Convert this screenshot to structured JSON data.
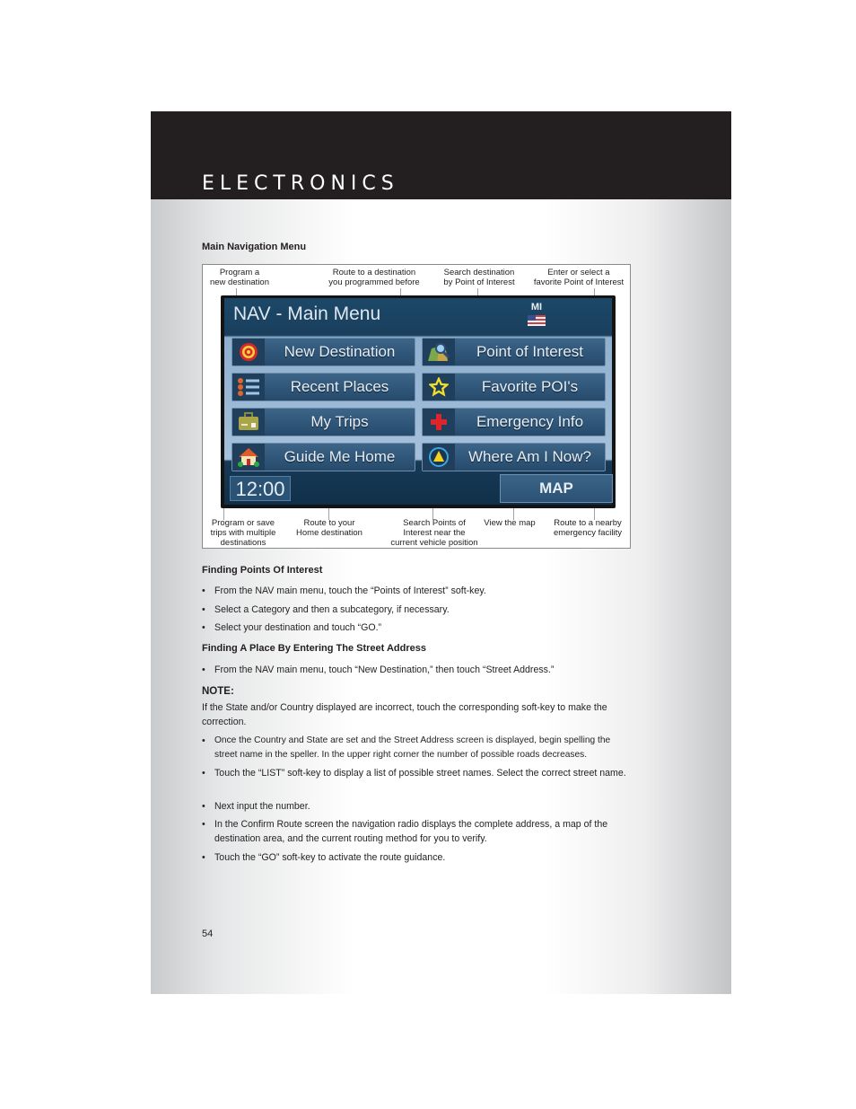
{
  "header": {
    "title": "ELECTRONICS"
  },
  "section_title": "Main Navigation Menu",
  "figure": {
    "callouts_top": [
      "Program a\nnew destination",
      "Route to a destination\nyou programmed before",
      "Search destination\nby Point of Interest",
      "Enter or select a\nfavorite Point of Interest"
    ],
    "callouts_bottom": [
      "Program or save\ntrips with multiple\ndestinations",
      "Route to your\nHome destination",
      "Search Points of\nInterest near the\ncurrent vehicle position",
      "View the map",
      "Route to a nearby\nemergency facility"
    ],
    "screen": {
      "title": "NAV - Main Menu",
      "state": "MI",
      "flag_icon": "us-flag-icon",
      "buttons": [
        {
          "label": "New Destination",
          "icon": "target-icon"
        },
        {
          "label": "Point of Interest",
          "icon": "map-search-icon"
        },
        {
          "label": "Recent Places",
          "icon": "list-icon"
        },
        {
          "label": "Favorite POI's",
          "icon": "star-icon"
        },
        {
          "label": "My Trips",
          "icon": "suitcase-icon"
        },
        {
          "label": "Emergency Info",
          "icon": "red-cross-icon"
        },
        {
          "label": "Guide Me Home",
          "icon": "house-icon"
        },
        {
          "label": "Where Am I Now?",
          "icon": "location-arrow-icon"
        }
      ],
      "time": "12:00",
      "map_button": "MAP"
    }
  },
  "sections": [
    {
      "title": "Finding Points Of Interest",
      "bullets": [
        "From the NAV main menu, touch the “Points of Interest” soft-key.",
        "Select a Category and then a subcategory, if necessary.",
        "Select your destination and touch “GO.”"
      ]
    },
    {
      "title": "Finding A Place By Entering The Street Address",
      "bullets": [
        "From the NAV main menu, touch “New Destination,” then touch “Street Address.”"
      ]
    }
  ],
  "note": {
    "label": "NOTE:",
    "text": "If the State and/or Country displayed are incorrect, touch the corresponding soft-key to make the correction."
  },
  "more_bullets": [
    "Once the Country and State are set and the Street Address screen is displayed, begin spelling the street name in the speller. In the upper right corner the number of possible roads decreases.",
    "Touch the “LIST” soft-key to display a list of possible street names. Select the correct street name.",
    "Next input the number.",
    " In the Confirm Route screen the navigation radio displays the complete address, a map of the destination area, and the current routing method for you to verify.",
    "Touch the “GO” soft-key to activate the route guidance."
  ],
  "bullet_char": "•",
  "page_number": "54"
}
